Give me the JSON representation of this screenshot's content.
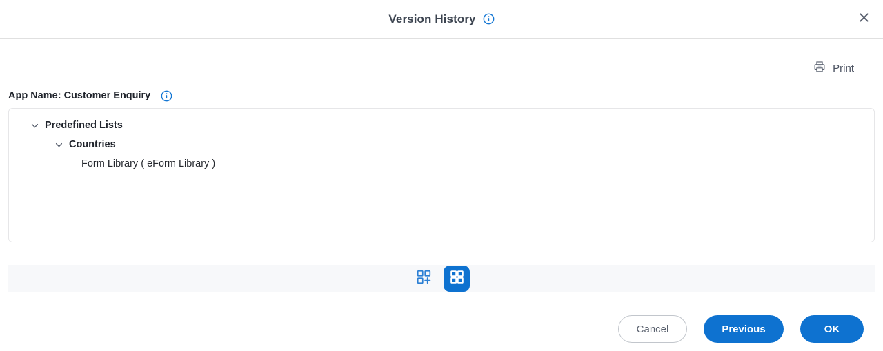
{
  "header": {
    "title": "Version History",
    "title_info_icon": "info-circle-icon",
    "close_icon": "close-icon"
  },
  "toolbar": {
    "print_label": "Print",
    "print_icon": "printer-icon"
  },
  "app_info": {
    "label": "App Name: Customer Enquiry",
    "info_icon": "info-circle-icon"
  },
  "tree": {
    "nodes": [
      {
        "label": "Predefined Lists",
        "level": 0,
        "expanded": true,
        "chevron_icon": "chevron-down-icon"
      },
      {
        "label": "Countries",
        "level": 1,
        "expanded": true,
        "chevron_icon": "chevron-down-icon"
      },
      {
        "label": "Form Library ( eForm Library )",
        "level": 2,
        "expanded": false,
        "chevron_icon": ""
      }
    ]
  },
  "pager": {
    "buttons": [
      {
        "name": "grid-add-view-button",
        "icon": "grid-plus-icon",
        "active": false
      },
      {
        "name": "grid-view-button",
        "icon": "grid-four-icon",
        "active": true
      }
    ]
  },
  "footer": {
    "cancel_label": "Cancel",
    "previous_label": "Previous",
    "ok_label": "OK"
  },
  "colors": {
    "accent_blue": "#0e72d0",
    "panel_border": "#e6e6e8",
    "strip_bg": "#f7f8fa",
    "text_dark": "#20242c",
    "text_muted": "#5a616e"
  }
}
